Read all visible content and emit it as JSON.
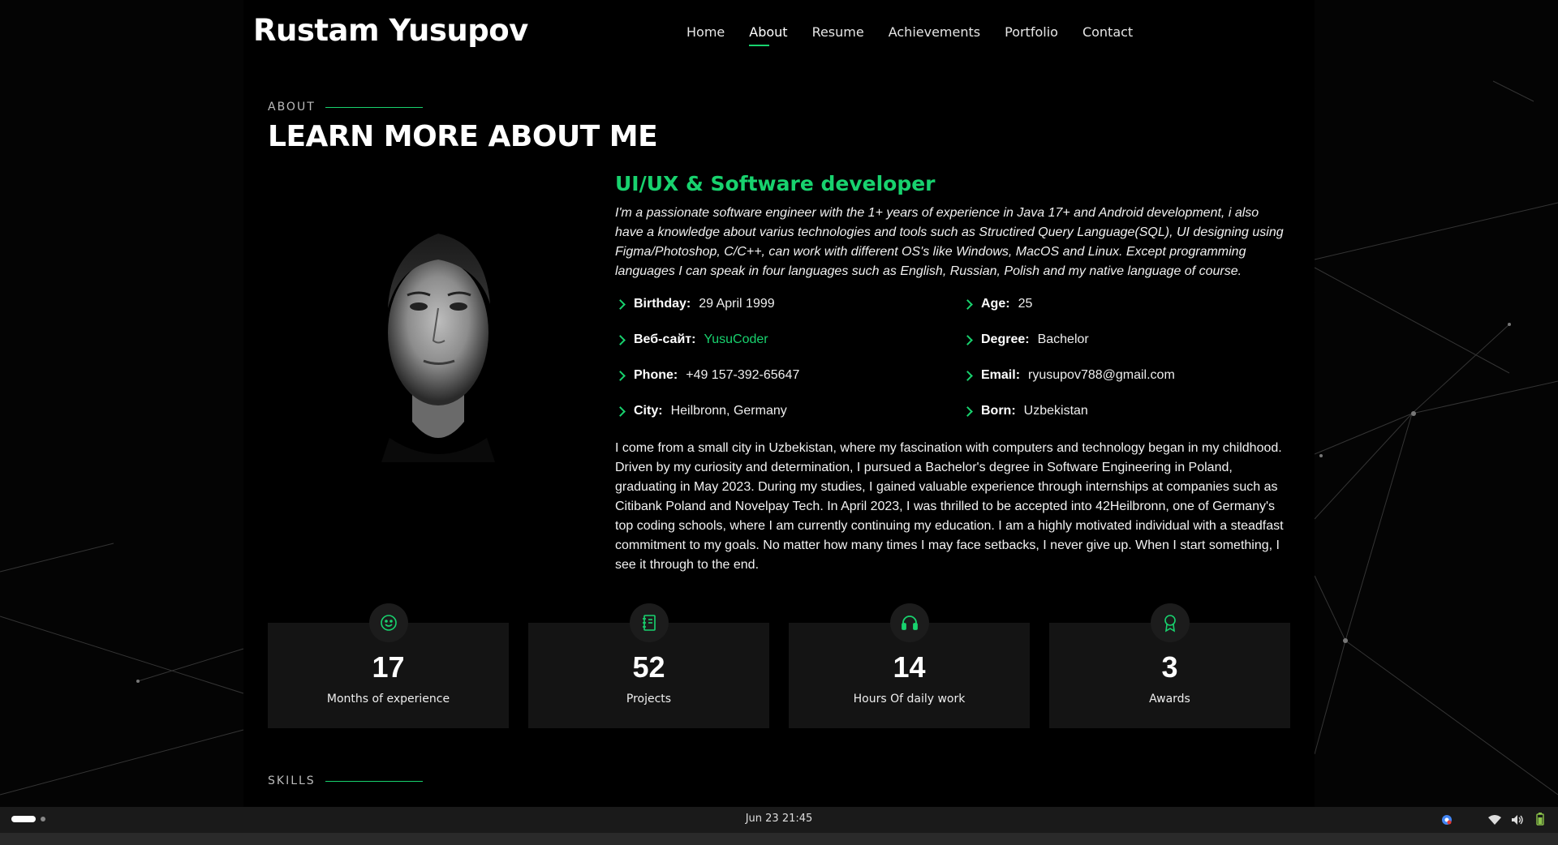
{
  "header": {
    "logo": "Rustam Yusupov",
    "nav": [
      "Home",
      "About",
      "Resume",
      "Achievements",
      "Portfolio",
      "Contact"
    ],
    "active_nav": "About"
  },
  "section": {
    "label": "ABOUT",
    "title": "LEARN MORE ABOUT ME"
  },
  "about": {
    "role": "UI/UX & Software developer",
    "intro": "I'm a passionate software engineer with the 1+ years of experience in Java 17+ and Android development, i also have a knowledge about varius technologies and tools such as Structired Query Language(SQL), UI designing using Figma/Photoshop, C/C++, can work with different OS's like Windows, MacOS and Linux. Except programming languages I can speak in four languages such as English, Russian, Polish and my native language of course.",
    "facts": [
      {
        "label": "Birthday:",
        "value": "29 April 1999"
      },
      {
        "label": "Age:",
        "value": "25"
      },
      {
        "label": "Веб-сайт:",
        "value": "YusuCoder"
      },
      {
        "label": "Degree:",
        "value": "Bachelor"
      },
      {
        "label": "Phone:",
        "value": "+49 157-392-65647"
      },
      {
        "label": "Email:",
        "value": "ryusupov788@gmail.com"
      },
      {
        "label": "City:",
        "value": "Heilbronn, Germany"
      },
      {
        "label": "Born:",
        "value": "Uzbekistan"
      }
    ],
    "bio": "I come from a small city in Uzbekistan, where my fascination with computers and technology began in my childhood. Driven by my curiosity and determination, I pursued a Bachelor's degree in Software Engineering in Poland, graduating in May 2023. During my studies, I gained valuable experience through internships at companies such as Citibank Poland and Novelpay Tech. In April 2023, I was thrilled to be accepted into 42Heilbronn, one of Germany's top coding schools, where I am currently continuing my education. I am a highly motivated individual with a steadfast commitment to my goals. No matter how many times I may face setbacks, I never give up. When I start something, I see it through to the end."
  },
  "counters": [
    {
      "number": "17",
      "label": "Months of experience",
      "icon": "smiley-icon"
    },
    {
      "number": "52",
      "label": "Projects",
      "icon": "journal-icon"
    },
    {
      "number": "14",
      "label": "Hours Of daily work",
      "icon": "headset-icon"
    },
    {
      "number": "3",
      "label": "Awards",
      "icon": "award-icon"
    }
  ],
  "skills_label": "SKILLS",
  "taskbar": {
    "clock": "Jun 23  21:45"
  },
  "colors": {
    "accent": "#18d26e",
    "background": "#000000",
    "card": "#141414"
  }
}
